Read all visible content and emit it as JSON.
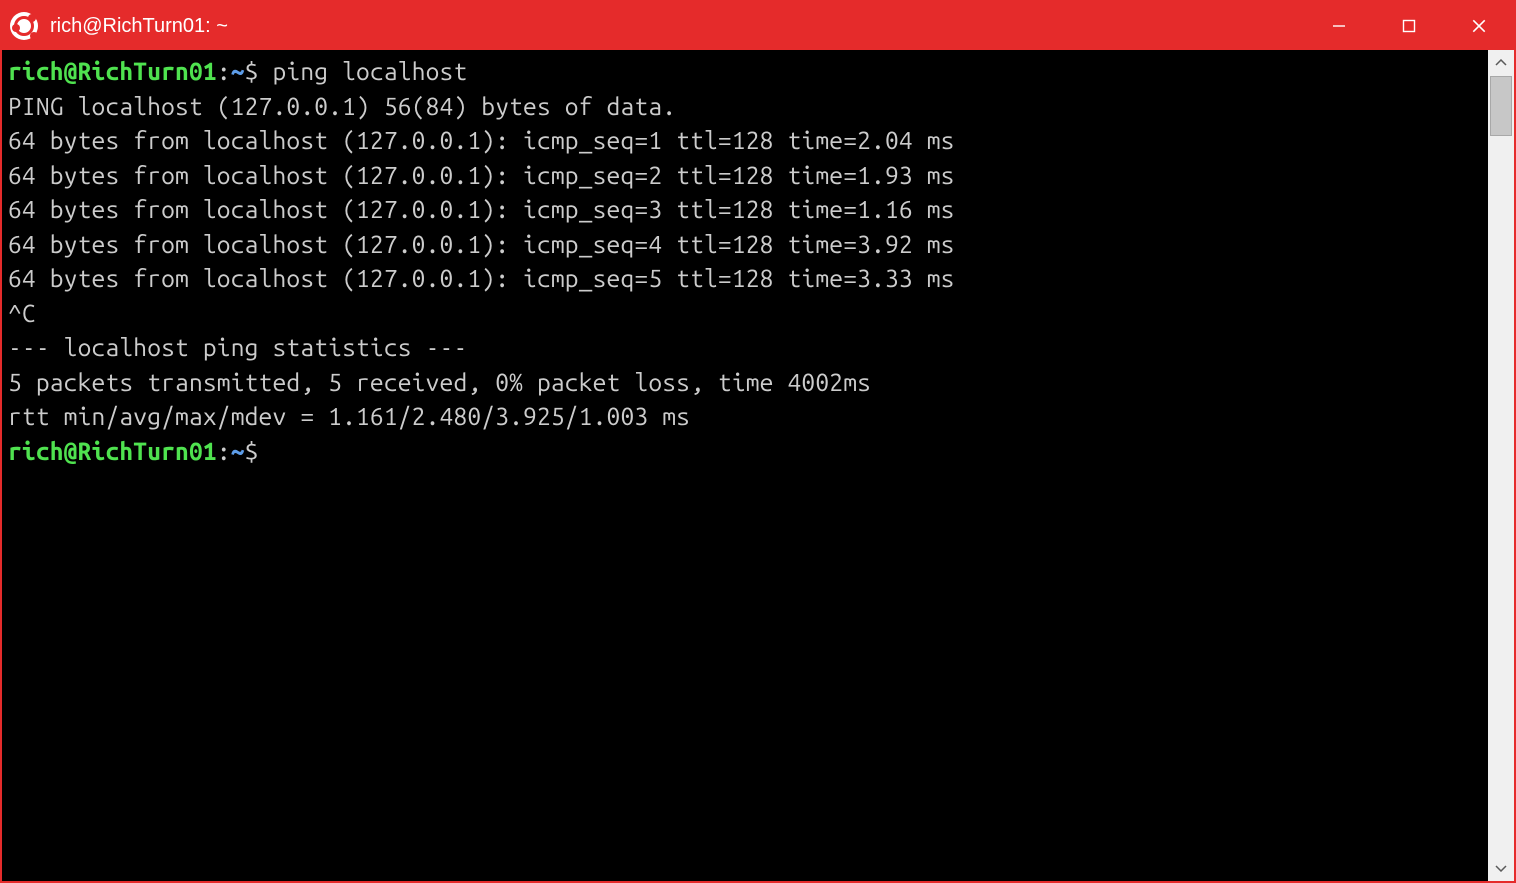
{
  "titlebar": {
    "title": "rich@RichTurn01: ~"
  },
  "prompt": {
    "user_host": "rich@RichTurn01",
    "separator": ":",
    "path": "~",
    "symbol": "$"
  },
  "commands": {
    "first": "ping localhost"
  },
  "output": {
    "header": "PING localhost (127.0.0.1) 56(84) bytes of data.",
    "replies": [
      "64 bytes from localhost (127.0.0.1): icmp_seq=1 ttl=128 time=2.04 ms",
      "64 bytes from localhost (127.0.0.1): icmp_seq=2 ttl=128 time=1.93 ms",
      "64 bytes from localhost (127.0.0.1): icmp_seq=3 ttl=128 time=1.16 ms",
      "64 bytes from localhost (127.0.0.1): icmp_seq=4 ttl=128 time=3.92 ms",
      "64 bytes from localhost (127.0.0.1): icmp_seq=5 ttl=128 time=3.33 ms"
    ],
    "interrupt": "^C",
    "stats_header": "--- localhost ping statistics ---",
    "stats_summary": "5 packets transmitted, 5 received, 0% packet loss, time 4002ms",
    "stats_rtt": "rtt min/avg/max/mdev = 1.161/2.480/3.925/1.003 ms"
  },
  "colors": {
    "titlebar_bg": "#e52b2b",
    "terminal_bg": "#000000",
    "terminal_fg": "#cccccc",
    "prompt_user": "#4fe24f",
    "prompt_path": "#5d9de9"
  }
}
